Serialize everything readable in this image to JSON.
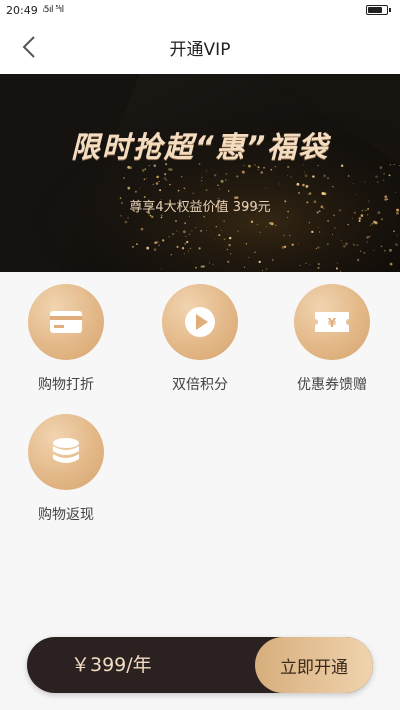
{
  "status_bar": {
    "time": "20:49",
    "signal_text": "ᵢ5ıl ⁵ᴵıl",
    "battery_level": 0.85
  },
  "nav": {
    "title": "开通VIP",
    "back_icon": "chevron-left-icon"
  },
  "banner": {
    "title": "限时抢超“惠”福袋",
    "subtitle": "尊享4大权益价值 399元",
    "colors": {
      "background": "#0c0a08",
      "gold": "#f4dcc0"
    }
  },
  "features": [
    {
      "label": "购物打折",
      "icon": "card-icon"
    },
    {
      "label": "双倍积分",
      "icon": "play-icon"
    },
    {
      "label": "优惠券馈赠",
      "icon": "coupon-icon"
    },
    {
      "label": "购物返现",
      "icon": "coins-icon"
    }
  ],
  "purchase": {
    "price": "￥399/年",
    "button": "立即开通",
    "colors": {
      "bar": "#2a2120",
      "button_start": "#d7ae7d",
      "button_end": "#f0d3ad"
    }
  }
}
